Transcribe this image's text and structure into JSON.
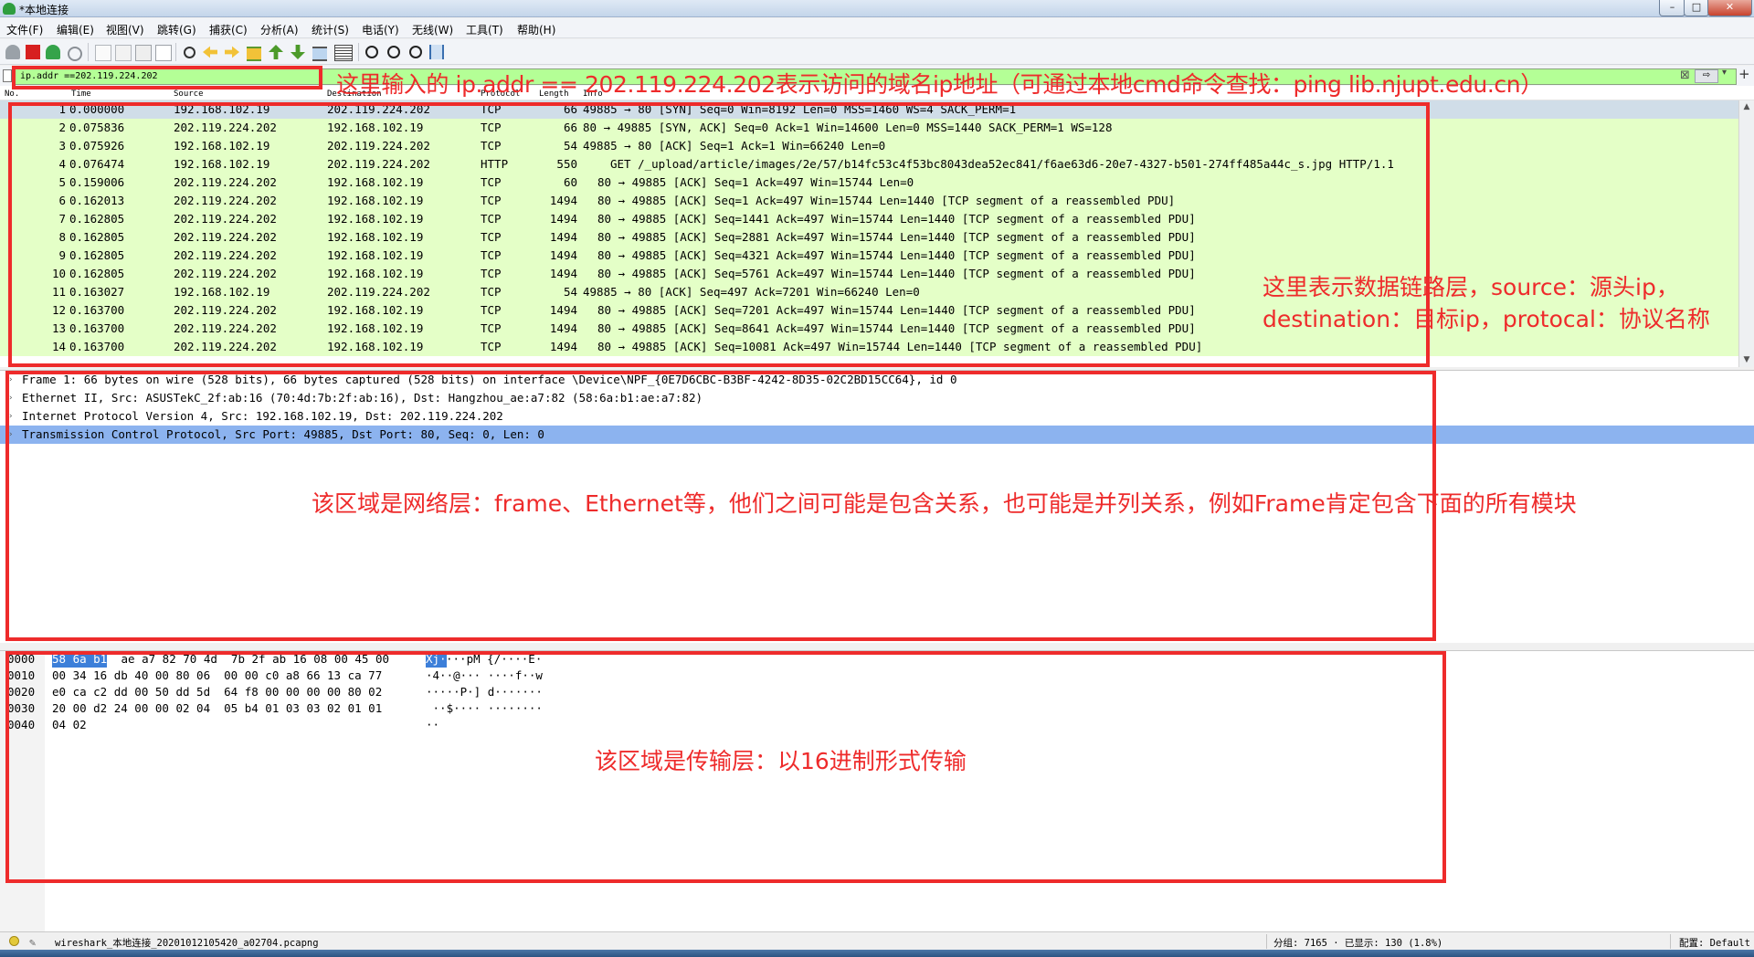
{
  "window": {
    "title": "*本地连接",
    "min": "–",
    "max": "□",
    "close": "✕"
  },
  "menu": [
    "文件(F)",
    "编辑(E)",
    "视图(V)",
    "跳转(G)",
    "捕获(C)",
    "分析(A)",
    "统计(S)",
    "电话(Y)",
    "无线(W)",
    "工具(T)",
    "帮助(H)"
  ],
  "filter": {
    "value": "ip.addr ==202.119.224.202",
    "apply": "⇨",
    "add": "+"
  },
  "columns": {
    "no": "No.",
    "time": "Time",
    "source": "Source",
    "destination": "Destination",
    "protocol": "Protocol",
    "length": "Length",
    "info": "Info"
  },
  "packets": [
    {
      "no": "1",
      "time": "0.000000",
      "src": "192.168.102.19",
      "dst": "202.119.224.202",
      "proto": "TCP",
      "len": "66",
      "info": "49885 → 80 [SYN] Seq=0 Win=8192 Len=0 MSS=1460 WS=4 SACK_PERM=1"
    },
    {
      "no": "2",
      "time": "0.075836",
      "src": "202.119.224.202",
      "dst": "192.168.102.19",
      "proto": "TCP",
      "len": "66",
      "info": "80 → 49885 [SYN, ACK] Seq=0 Ack=1 Win=14600 Len=0 MSS=1440 SACK_PERM=1 WS=128"
    },
    {
      "no": "3",
      "time": "0.075926",
      "src": "192.168.102.19",
      "dst": "202.119.224.202",
      "proto": "TCP",
      "len": "54",
      "info": "49885 → 80 [ACK] Seq=1 Ack=1 Win=66240 Len=0"
    },
    {
      "no": "4",
      "time": "0.076474",
      "src": "192.168.102.19",
      "dst": "202.119.224.202",
      "proto": "HTTP",
      "len": "550",
      "info": "GET /_upload/article/images/2e/57/b14fc53c4f53bc8043dea52ec841/f6ae63d6-20e7-4327-b501-274ff485a44c_s.jpg HTTP/1.1"
    },
    {
      "no": "5",
      "time": "0.159006",
      "src": "202.119.224.202",
      "dst": "192.168.102.19",
      "proto": "TCP",
      "len": "60",
      "info": "80 → 49885 [ACK] Seq=1 Ack=497 Win=15744 Len=0"
    },
    {
      "no": "6",
      "time": "0.162013",
      "src": "202.119.224.202",
      "dst": "192.168.102.19",
      "proto": "TCP",
      "len": "1494",
      "info": "80 → 49885 [ACK] Seq=1 Ack=497 Win=15744 Len=1440 [TCP segment of a reassembled PDU]"
    },
    {
      "no": "7",
      "time": "0.162805",
      "src": "202.119.224.202",
      "dst": "192.168.102.19",
      "proto": "TCP",
      "len": "1494",
      "info": "80 → 49885 [ACK] Seq=1441 Ack=497 Win=15744 Len=1440 [TCP segment of a reassembled PDU]"
    },
    {
      "no": "8",
      "time": "0.162805",
      "src": "202.119.224.202",
      "dst": "192.168.102.19",
      "proto": "TCP",
      "len": "1494",
      "info": "80 → 49885 [ACK] Seq=2881 Ack=497 Win=15744 Len=1440 [TCP segment of a reassembled PDU]"
    },
    {
      "no": "9",
      "time": "0.162805",
      "src": "202.119.224.202",
      "dst": "192.168.102.19",
      "proto": "TCP",
      "len": "1494",
      "info": "80 → 49885 [ACK] Seq=4321 Ack=497 Win=15744 Len=1440 [TCP segment of a reassembled PDU]"
    },
    {
      "no": "10",
      "time": "0.162805",
      "src": "202.119.224.202",
      "dst": "192.168.102.19",
      "proto": "TCP",
      "len": "1494",
      "info": "80 → 49885 [ACK] Seq=5761 Ack=497 Win=15744 Len=1440 [TCP segment of a reassembled PDU]"
    },
    {
      "no": "11",
      "time": "0.163027",
      "src": "192.168.102.19",
      "dst": "202.119.224.202",
      "proto": "TCP",
      "len": "54",
      "info": "49885 → 80 [ACK] Seq=497 Ack=7201 Win=66240 Len=0"
    },
    {
      "no": "12",
      "time": "0.163700",
      "src": "202.119.224.202",
      "dst": "192.168.102.19",
      "proto": "TCP",
      "len": "1494",
      "info": "80 → 49885 [ACK] Seq=7201 Ack=497 Win=15744 Len=1440 [TCP segment of a reassembled PDU]"
    },
    {
      "no": "13",
      "time": "0.163700",
      "src": "202.119.224.202",
      "dst": "192.168.102.19",
      "proto": "TCP",
      "len": "1494",
      "info": "80 → 49885 [ACK] Seq=8641 Ack=497 Win=15744 Len=1440 [TCP segment of a reassembled PDU]"
    },
    {
      "no": "14",
      "time": "0.163700",
      "src": "202.119.224.202",
      "dst": "192.168.102.19",
      "proto": "TCP",
      "len": "1494",
      "info": "80 → 49885 [ACK] Seq=10081 Ack=497 Win=15744 Len=1440 [TCP segment of a reassembled PDU]"
    }
  ],
  "details": [
    "Frame 1: 66 bytes on wire (528 bits), 66 bytes captured (528 bits) on interface \\Device\\NPF_{0E7D6CBC-B3BF-4242-8D35-02C2BD15CC64}, id 0",
    "Ethernet II, Src: ASUSTekC_2f:ab:16 (70:4d:7b:2f:ab:16), Dst: Hangzhou_ae:a7:82 (58:6a:b1:ae:a7:82)",
    "Internet Protocol Version 4, Src: 192.168.102.19, Dst: 202.119.224.202",
    "Transmission Control Protocol, Src Port: 49885, Dst Port: 80, Seq: 0, Len: 0"
  ],
  "bytes": [
    {
      "offset": "0000",
      "hl": "58 6a b1",
      "hex": " ae a7 82 70 4d  7b 2f ab 16 08 00 45 00",
      "ascii_hl": "Xj·",
      "ascii": "···pM {/····E·"
    },
    {
      "offset": "0010",
      "hl": "",
      "hex": "00 34 16 db 40 00 80 06  00 00 c0 a8 66 13 ca 77",
      "ascii_hl": "",
      "ascii": "·4··@··· ····f··w"
    },
    {
      "offset": "0020",
      "hl": "",
      "hex": "e0 ca c2 dd 00 50 dd 5d  64 f8 00 00 00 00 80 02",
      "ascii_hl": "",
      "ascii": "·····P·] d·······"
    },
    {
      "offset": "0030",
      "hl": "",
      "hex": "20 00 d2 24 00 00 02 04  05 b4 01 03 03 02 01 01",
      "ascii_hl": "",
      "ascii": " ··$···· ········"
    },
    {
      "offset": "0040",
      "hl": "",
      "hex": "04 02",
      "ascii_hl": "",
      "ascii": "··"
    }
  ],
  "status": {
    "file": "wireshark_本地连接_20201012105420_a02704.pcapng",
    "stats": "分组: 7165 · 已显示: 130 (1.8%)",
    "profile": "配置: Default"
  },
  "annotations": {
    "filter_note": "这里输入的 ip.addr == 202.119.224.202表示访问的域名ip地址（可通过本地cmd命令查找：ping lib.njupt.edu.cn）",
    "list_note_1": "这里表示数据链路层，source：源头ip，",
    "list_note_2": "destination：目标ip，protocal：协议名称",
    "details_note": "该区域是网络层：frame、Ethernet等，他们之间可能是包含关系，也可能是并列关系，例如Frame肯定包含下面的所有模块",
    "bytes_note": "该区域是传输层：以16进制形式传输"
  },
  "colors": {
    "annotation": "#ee2b2b",
    "filter_ok": "#b4ff96",
    "row_tcp": "#e4ffc7",
    "selected": "#8cb3ef"
  }
}
